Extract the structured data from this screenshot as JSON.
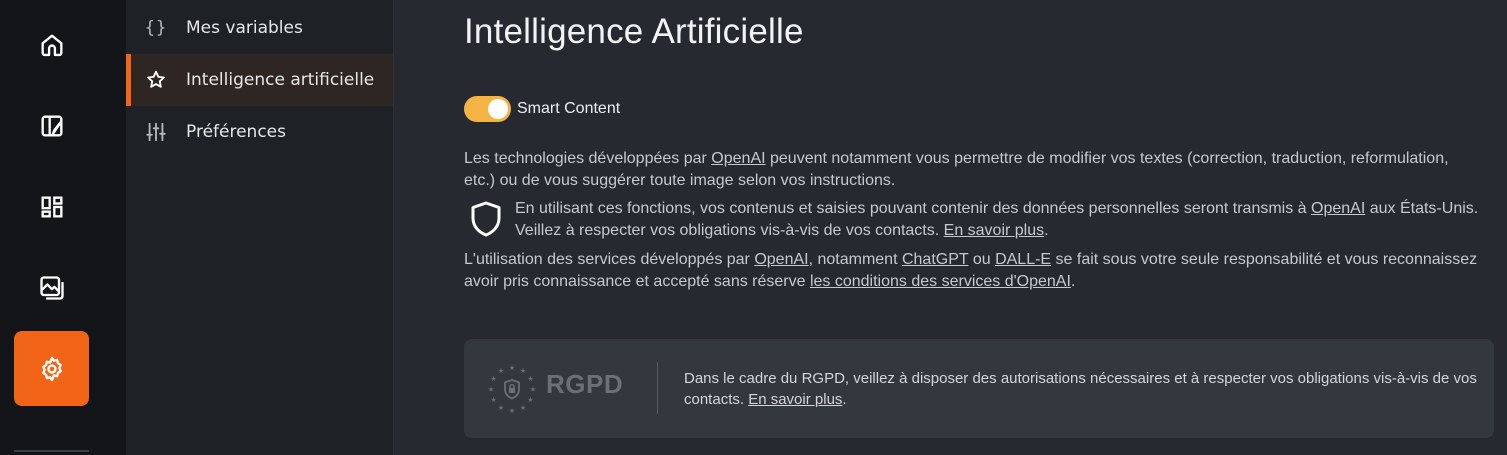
{
  "rail": {
    "items": [
      {
        "icon": "home-icon"
      },
      {
        "icon": "brush-icon"
      },
      {
        "icon": "dashboard-icon"
      },
      {
        "icon": "images-icon"
      },
      {
        "icon": "gear-icon",
        "active": true
      }
    ],
    "accent": "#f26519"
  },
  "submenu": {
    "items": [
      {
        "icon": "braces-icon",
        "icon_glyph": "{}",
        "label": "Mes variables"
      },
      {
        "icon": "star-icon",
        "label": "Intelligence artificielle",
        "active": true
      },
      {
        "icon": "sliders-icon",
        "label": "Préférences"
      }
    ]
  },
  "main": {
    "title": "Intelligence Artificielle",
    "toggle": {
      "label": "Smart Content",
      "on": true,
      "color": "#f5b344"
    },
    "p1": {
      "t1": "Les technologies développées par ",
      "link1": "OpenAI",
      "t2": " peuvent notamment vous permettre de modifier vos textes (correction, traduction, reformulation, etc.) ou de vous suggérer toute image selon vos instructions."
    },
    "p2": {
      "t1": "En utilisant ces fonctions, vos contenus et saisies pouvant contenir des données personnelles seront transmis à ",
      "link1": "OpenAI",
      "t2": " aux États-Unis. Veillez à respecter vos obligations vis-à-vis de vos contacts. ",
      "link2": "En savoir plus",
      "t3": "."
    },
    "p3": {
      "t1": "L'utilisation des services développés par ",
      "link1": "OpenAI",
      "t2": ", notamment ",
      "link2": "ChatGPT",
      "t3": " ou ",
      "link3": "DALL-E",
      "t4": " se fait sous votre seule responsabilité et vous reconnaissez avoir pris connaissance et accepté sans réserve ",
      "link4": "les conditions des services d'OpenAI",
      "t5": "."
    },
    "rgpd": {
      "logo_text": "RGPD",
      "t1": "Dans le cadre du RGPD, veillez à disposer des autorisations nécessaires et à respecter vos obligations vis-à-vis de vos contacts. ",
      "link": "En savoir plus",
      "t2": "."
    }
  }
}
